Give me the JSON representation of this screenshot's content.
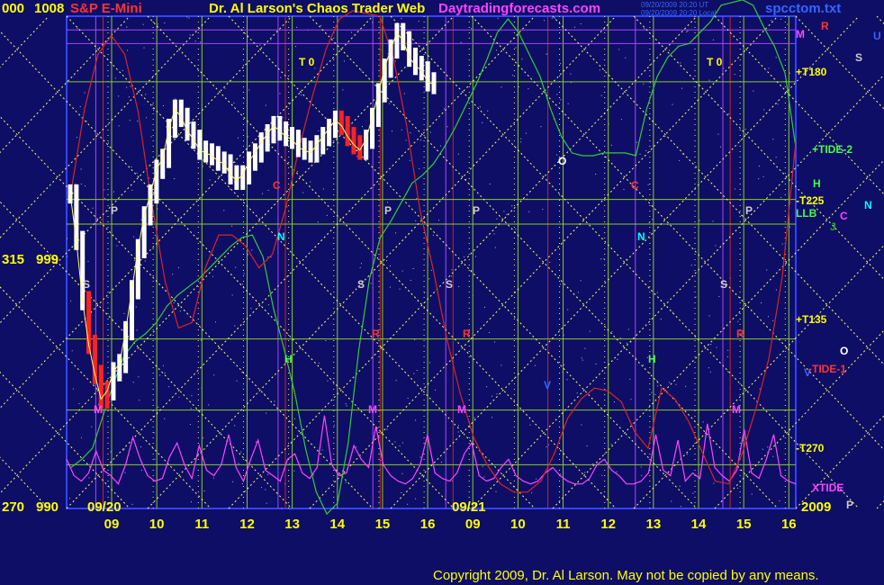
{
  "header": {
    "left_scale": "000",
    "top_price": "1008",
    "symbol": "S&P E-Mini",
    "title": "Dr. Al Larson's Chaos Trader Web",
    "website": "Daytradingforecasts.com",
    "timestamp_1": "09/20/2009 20:20 UT",
    "timestamp_2": "09/20/2009 20:20 Local",
    "file": "spcctom.txt"
  },
  "left_axis": [
    {
      "scale": "000",
      "price": "1008"
    },
    {
      "scale": "315",
      "price": "999"
    },
    {
      "scale": "270",
      "price": "990"
    }
  ],
  "copyright": "Copyright 2009, Dr. Al Larson. May not be copied by any means.",
  "colors": {
    "background": "#0e0e66",
    "price_bar": "#ffffff",
    "gann_line": "#ffff66",
    "grid": "#88cc22",
    "xtide": "#ff44ff",
    "tide": "#33cc33",
    "red_flux": "#dd2222"
  },
  "chart_data": {
    "type": "line",
    "title": "S&P E-Mini",
    "ylim": [
      990,
      1008
    ],
    "y_ticks": [
      "1008",
      "999",
      "990"
    ],
    "x_labels": [
      "09",
      "10",
      "11",
      "12",
      "13",
      "14",
      "15",
      "16",
      "09",
      "10",
      "11",
      "12",
      "13",
      "14",
      "15",
      "16"
    ],
    "date_labels": [
      "09/20",
      "09/21"
    ],
    "year_label": "2009",
    "right_labels": [
      {
        "text": "M",
        "color": "#ff44ff"
      },
      {
        "text": "R",
        "color": "#ff3333"
      },
      {
        "text": "U",
        "color": "#3366ff"
      },
      {
        "text": "S",
        "color": "#cccccc"
      },
      {
        "text": "+T180",
        "color": "#ffff00"
      },
      {
        "text": "+TIDE-2",
        "color": "#44ff44"
      },
      {
        "text": "H",
        "color": "#44ff44"
      },
      {
        "text": "-T225",
        "color": "#ffff00"
      },
      {
        "text": "N",
        "color": "#00ffff"
      },
      {
        "text": "LLB",
        "color": "#44ff44"
      },
      {
        "text": "C",
        "color": "#ff44ff"
      },
      {
        "text": "J",
        "color": "#22aa22"
      },
      {
        "text": "+T135",
        "color": "#ffff00"
      },
      {
        "text": "O",
        "color": "#ffffff"
      },
      {
        "text": "V",
        "color": "#3366ff"
      },
      {
        "text": "-TIDE-1",
        "color": "#ff3333"
      },
      {
        "text": "-T270",
        "color": "#ffff00"
      },
      {
        "text": "XTIDE",
        "color": "#ff44ff"
      },
      {
        "text": "P",
        "color": "#cccccc"
      }
    ],
    "price_series": {
      "name": "S&P E-Mini",
      "values": [
        1001.5,
        999.8,
        997.6,
        996.0,
        994.9,
        994.0,
        994.3,
        995.0,
        995.3,
        996.5,
        998.0,
        999.5,
        1000.7,
        1001.5,
        1002.4,
        1002.8,
        1003.9,
        1004.6,
        1004.3,
        1003.8,
        1003.5,
        1003.1,
        1003.0,
        1002.9,
        1002.7,
        1002.6,
        1002.2,
        1002.0,
        1002.2,
        1002.7,
        1003.0,
        1003.4,
        1003.7,
        1004.0,
        1003.8,
        1003.6,
        1003.5,
        1003.2,
        1003.1,
        1003.0,
        1003.3,
        1003.6,
        1003.9,
        1004.2,
        1004.0,
        1003.6,
        1003.3,
        1003.1,
        1003.5,
        1004.3,
        1005.2,
        1006.1,
        1006.8,
        1007.4,
        1007.1,
        1006.5,
        1006.2,
        1006.0,
        1005.6,
        1005.5
      ]
    },
    "xtide_series": {
      "name": "XTIDE",
      "values": [
        991.8,
        991.2,
        991.0,
        991.3,
        992.1,
        991.4,
        991.2,
        990.9,
        991.6,
        992.6,
        991.8,
        991.2,
        991.0,
        991.1,
        991.9,
        992.4,
        991.6,
        991.1,
        992.3,
        991.4,
        991.2,
        991.6,
        992.7,
        991.5,
        991.0,
        991.8,
        992.5,
        991.4,
        991.2,
        991.0,
        991.8,
        992.0,
        991.3,
        991.1,
        991.5,
        993.4,
        991.6,
        991.2,
        991.3,
        992.3,
        991.8,
        991.5,
        993.0,
        991.6,
        991.2,
        991.0,
        990.9,
        991.1,
        991.6,
        992.7,
        991.3,
        991.1,
        991.0,
        991.3,
        992.0,
        992.4,
        991.2,
        991.0,
        991.1,
        991.5,
        991.8,
        991.2,
        991.0,
        990.9,
        991.0,
        991.3,
        991.5,
        991.2,
        991.0,
        990.9,
        990.9,
        991.1,
        991.6,
        991.8,
        991.4,
        991.2,
        990.9,
        990.9,
        991.0,
        991.3,
        992.7,
        991.4,
        991.2,
        992.5,
        991.0,
        991.3,
        991.1,
        993.1,
        991.5,
        991.2,
        991.0,
        991.4,
        992.9,
        991.3,
        991.1,
        991.8,
        992.7,
        991.2,
        991.0,
        990.9
      ]
    },
    "tide_series": {
      "name": "+TIDE-2",
      "values": [
        991.5,
        991.8,
        992.2,
        993.4,
        994.6,
        995.6,
        996.1,
        996.4,
        996.8,
        997.4,
        997.8,
        998.1,
        998.4,
        998.8,
        999.2,
        999.6,
        999.9,
        1000.0,
        999.2,
        997.3,
        995.8,
        994.2,
        992.2,
        990.6,
        989.8,
        990.2,
        992.4,
        995.8,
        998.4,
        999.9,
        1000.5,
        1001.2,
        1001.9,
        1002.2,
        1002.6,
        1003.2,
        1003.9,
        1004.7,
        1005.5,
        1006.4,
        1007.4,
        1007.9,
        1007.4,
        1006.6,
        1005.8,
        1004.6,
        1003.6,
        1003.0,
        1002.9,
        1002.9,
        1003.0,
        1003.0,
        1003.0,
        1002.9,
        1004.6,
        1005.8,
        1006.5,
        1006.9,
        1007.0,
        1007.4,
        1007.8,
        1008.4,
        1008.5,
        1008.6,
        1008.4,
        1007.6,
        1006.9,
        1005.9,
        1003.2
      ]
    },
    "red_flux_series": {
      "name": "-TIDE-1",
      "values": [
        1001.6,
        1004.6,
        1006.6,
        1007.3,
        1006.6,
        1004.5,
        1001.2,
        998.3,
        996.6,
        996.8,
        998.8,
        1000.0,
        1000.0,
        999.6,
        998.8,
        999.3,
        1001.0,
        1003.2,
        1005.1,
        1006.8,
        1007.9,
        1008.2,
        1008.1,
        1008.0,
        1006.5,
        1004.0,
        1000.9,
        998.7,
        996.2,
        994.2,
        992.6,
        991.6,
        990.9,
        990.6,
        990.6,
        991.0,
        992.0,
        993.3,
        994.0,
        994.4,
        994.3,
        993.9,
        992.8,
        992.2,
        994.4,
        994.0,
        993.2,
        992.1,
        991.0,
        990.9,
        992.0,
        993.6,
        995.5,
        998.5,
        1003.4
      ]
    },
    "gann_levels": [
      {
        "label": "+T180",
        "value": 1005.6
      },
      {
        "label": "-T225",
        "value": 1001.3
      },
      {
        "label": "LLB",
        "value": 1000.4
      },
      {
        "label": "+T135",
        "value": 996.2
      },
      {
        "label": "-TIDE-1",
        "value": 993.6
      },
      {
        "label": "-T270",
        "value": 991.6
      }
    ]
  }
}
